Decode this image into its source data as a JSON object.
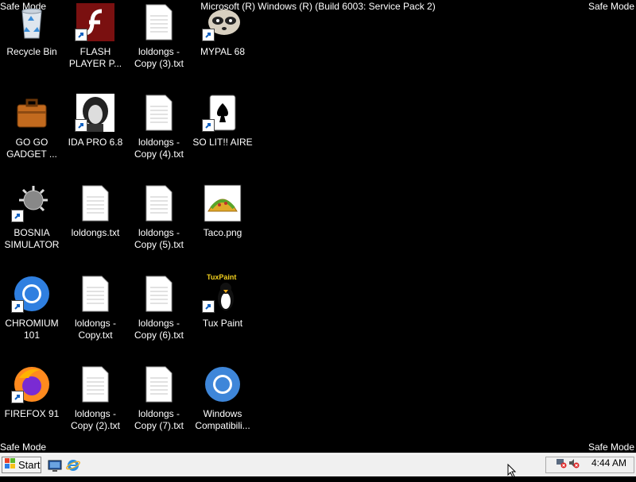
{
  "safe_mode_label": "Safe Mode",
  "banner": "Microsoft (R) Windows (R) (Build 6003: Service Pack 2)",
  "icons": [
    {
      "label": "Recycle Bin",
      "icon": "recycle-bin-icon"
    },
    {
      "label": "FLASH PLAYER P...",
      "icon": "flash-player-icon"
    },
    {
      "label": "loldongs - Copy (3).txt",
      "icon": "text-file-icon"
    },
    {
      "label": "MYPAL 68",
      "icon": "raccoon-icon"
    },
    {
      "label": "GO GO GADGET ...",
      "icon": "briefcase-icon"
    },
    {
      "label": "IDA PRO 6.8",
      "icon": "ida-portrait-icon"
    },
    {
      "label": "loldongs - Copy (4).txt",
      "icon": "text-file-icon"
    },
    {
      "label": "SO LIT!! AIRE",
      "icon": "solitaire-icon"
    },
    {
      "label": "BOSNIA SIMULATOR",
      "icon": "mace-icon"
    },
    {
      "label": "loldongs.txt",
      "icon": "text-file-icon"
    },
    {
      "label": "loldongs - Copy (5).txt",
      "icon": "text-file-icon"
    },
    {
      "label": "Taco.png",
      "icon": "taco-icon"
    },
    {
      "label": "CHROMIUM 101",
      "icon": "chromium-icon"
    },
    {
      "label": "loldongs - Copy.txt",
      "icon": "text-file-icon"
    },
    {
      "label": "loldongs - Copy (6).txt",
      "icon": "text-file-icon"
    },
    {
      "label": "Tux Paint",
      "icon": "tux-paint-icon"
    },
    {
      "label": "FIREFOX 91",
      "icon": "firefox-icon"
    },
    {
      "label": "loldongs - Copy (2).txt",
      "icon": "text-file-icon"
    },
    {
      "label": "loldongs - Copy (7).txt",
      "icon": "text-file-icon"
    },
    {
      "label": "Windows Compatibili...",
      "icon": "chrome-icon"
    }
  ],
  "taskbar": {
    "start_label": "Start",
    "clock": "4:44 AM",
    "tux_paint_title": "TuxPaint"
  }
}
